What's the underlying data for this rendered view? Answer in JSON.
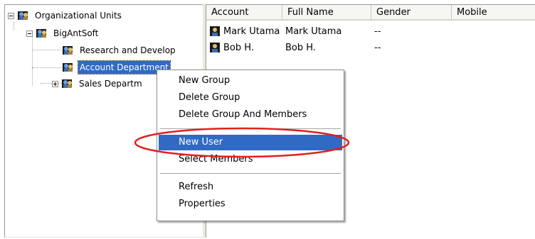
{
  "tree": {
    "root_label": "Organizational Units",
    "company_label": "BigAntSoft",
    "departments": [
      {
        "label": "Research and Develop"
      },
      {
        "label": "Account Department"
      },
      {
        "label": "Sales Departm"
      }
    ]
  },
  "list": {
    "columns": [
      "Account",
      "Full Name",
      "Gender",
      "Mobile"
    ],
    "rows": [
      {
        "account": "Mark Utama",
        "full_name": "Mark Utama",
        "gender": "--"
      },
      {
        "account": "Bob H.",
        "full_name": "Bob H.",
        "gender": "--"
      }
    ]
  },
  "context_menu": {
    "items": [
      {
        "label": "New Group"
      },
      {
        "label": "Delete Group"
      },
      {
        "label": "Delete Group And Members"
      },
      {
        "label": "New User"
      },
      {
        "label": "Select Members"
      },
      {
        "label": "Refresh"
      },
      {
        "label": "Properties"
      }
    ],
    "highlighted": "New User"
  },
  "colors": {
    "selection": "#316ac5",
    "annotation": "#e0201c"
  },
  "icons": {
    "tree_node": "users-group-icon",
    "list_user": "user-icon"
  }
}
